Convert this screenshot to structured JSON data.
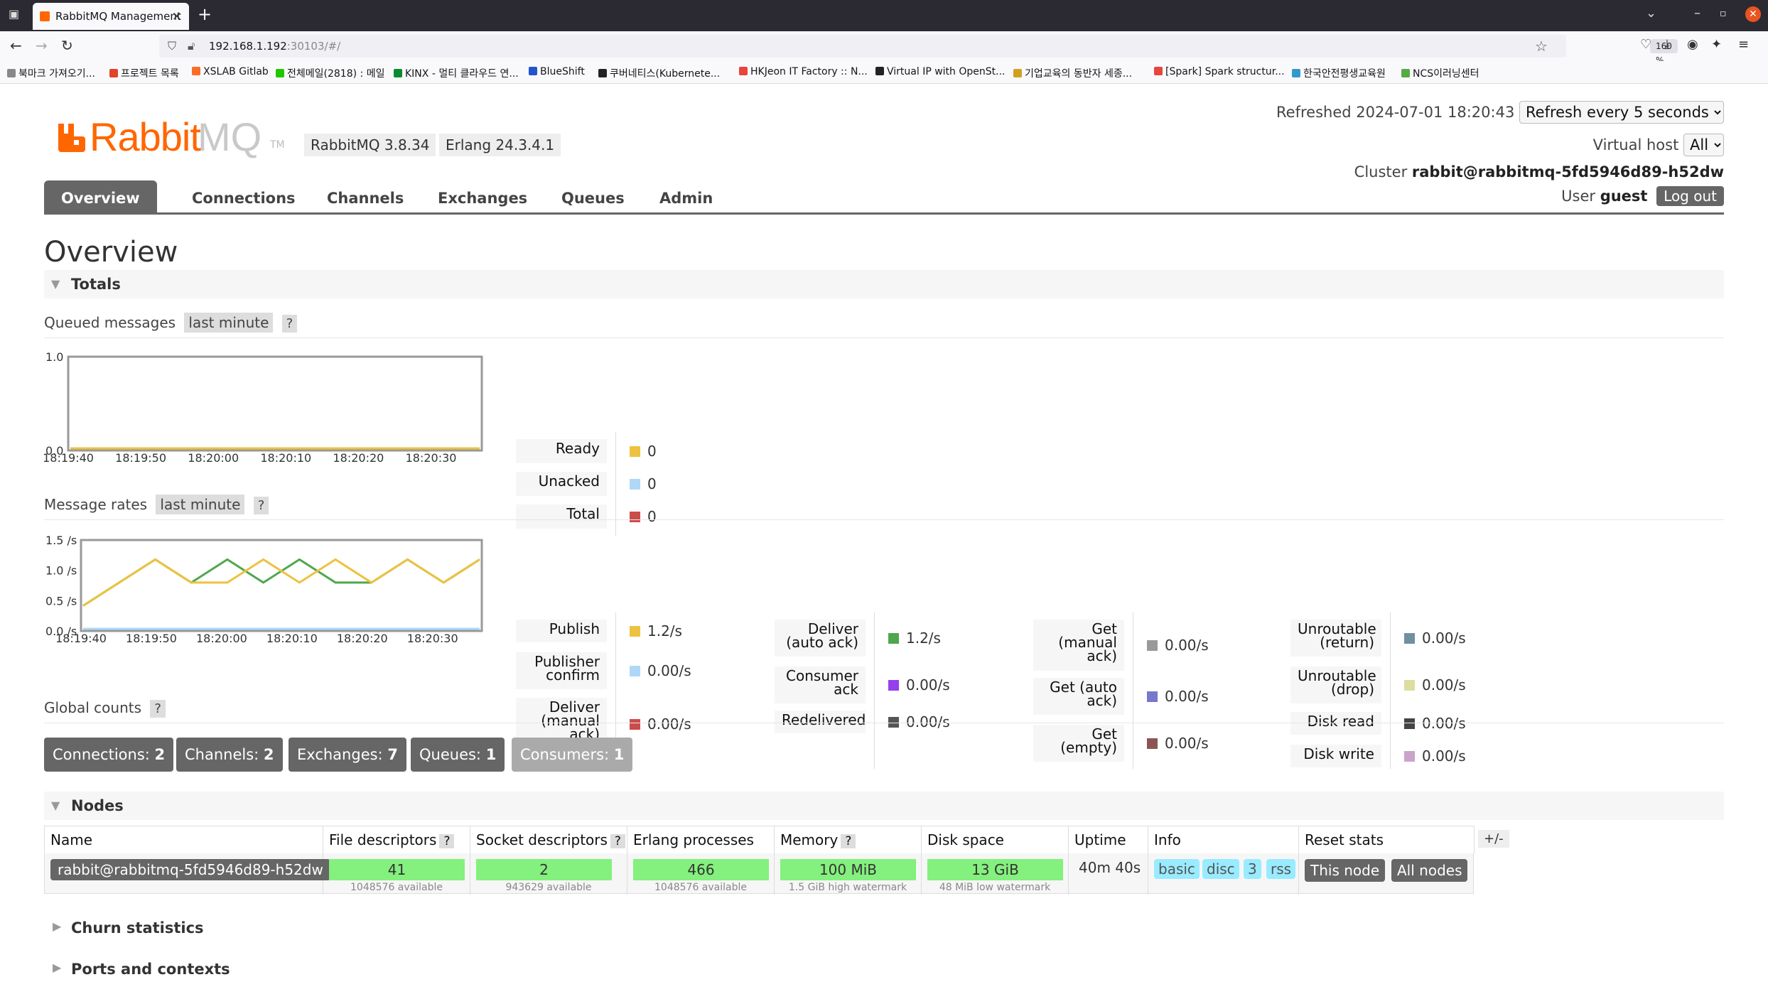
{
  "browser": {
    "tab_title": "RabbitMQ Management",
    "url_host": "192.168.1.192",
    "url_rest": ":30103/#/",
    "zoom": "160 %"
  },
  "bookmarks": [
    {
      "label": "북마크 가져오기...",
      "color": "#888888"
    },
    {
      "label": "프로젝트 목록",
      "color": "#e24329"
    },
    {
      "label": "XSLAB Gitlab",
      "color": "#fc6d26"
    },
    {
      "label": "전체메일(2818) : 메일",
      "color": "#1ec800"
    },
    {
      "label": "KINX - 멀티 클라우드 연...",
      "color": "#0a8a2e"
    },
    {
      "label": "BlueShift",
      "color": "#2255cc"
    },
    {
      "label": "쿠버네티스(Kubernete...",
      "color": "#222222"
    },
    {
      "label": "HKJeon IT Factory :: N...",
      "color": "#e8453c"
    },
    {
      "label": "Virtual IP with OpenSt...",
      "color": "#222222"
    },
    {
      "label": "기업교육의 동반자 세종...",
      "color": "#d0a020"
    },
    {
      "label": "[Spark] Spark structur...",
      "color": "#e8453c"
    },
    {
      "label": "한국안전평생교육원",
      "color": "#3399cc"
    },
    {
      "label": "NCS이러닝센터",
      "color": "#55aa44"
    }
  ],
  "header": {
    "logo_text_1": "Rabbit",
    "logo_text_2": "MQ",
    "logo_tm": "TM",
    "version": "RabbitMQ 3.8.34",
    "erlang": "Erlang 24.3.4.1",
    "refreshed_label": "Refreshed",
    "refreshed_time": "2024-07-01 18:20:43",
    "refresh_option": "Refresh every 5 seconds",
    "vhost_label": "Virtual host",
    "vhost_value": "All",
    "cluster_label": "Cluster",
    "cluster_name": "rabbit@rabbitmq-5fd5946d89-h52dw",
    "user_label": "User",
    "user_name": "guest",
    "logout": "Log out"
  },
  "menu": [
    "Overview",
    "Connections",
    "Channels",
    "Exchanges",
    "Queues",
    "Admin"
  ],
  "page_title": "Overview",
  "totals": {
    "title": "Totals",
    "queued_label": "Queued messages",
    "queued_range": "last minute",
    "rates_label": "Message rates",
    "rates_range": "last minute",
    "help": "?"
  },
  "queued_legend": [
    {
      "label": "Ready",
      "value": "0",
      "color": "#edc240"
    },
    {
      "label": "Unacked",
      "value": "0",
      "color": "#afd8f8"
    },
    {
      "label": "Total",
      "value": "0",
      "color": "#cb4b4b"
    }
  ],
  "rates_legend": [
    [
      {
        "label": "Publish",
        "value": "1.2/s",
        "color": "#edc240"
      },
      {
        "label": "Publisher confirm",
        "value": "0.00/s",
        "color": "#afd8f8"
      },
      {
        "label": "Deliver (manual ack)",
        "value": "0.00/s",
        "color": "#cb4b4b"
      }
    ],
    [
      {
        "label": "Deliver (auto ack)",
        "value": "1.2/s",
        "color": "#4da74d"
      },
      {
        "label": "Consumer ack",
        "value": "0.00/s",
        "color": "#9440ed"
      },
      {
        "label": "Redelivered",
        "value": "0.00/s",
        "color": "#555555"
      }
    ],
    [
      {
        "label": "Get (manual ack)",
        "value": "0.00/s",
        "color": "#999999"
      },
      {
        "label": "Get (auto ack)",
        "value": "0.00/s",
        "color": "#7777cc"
      },
      {
        "label": "Get (empty)",
        "value": "0.00/s",
        "color": "#8c5555"
      }
    ],
    [
      {
        "label": "Unroutable (return)",
        "value": "0.00/s",
        "color": "#7090a0"
      },
      {
        "label": "Unroutable (drop)",
        "value": "0.00/s",
        "color": "#dddda0"
      },
      {
        "label": "Disk read",
        "value": "0.00/s",
        "color": "#444444"
      },
      {
        "label": "Disk write",
        "value": "0.00/s",
        "color": "#c9a5c9"
      }
    ]
  ],
  "chart_data": [
    {
      "type": "line",
      "x": [
        "18:19:40",
        "18:19:50",
        "18:20:00",
        "18:20:10",
        "18:20:20",
        "18:20:30"
      ],
      "ylim": [
        0,
        1
      ],
      "y_ticks": [
        "0.0",
        "1.0"
      ],
      "series": [
        {
          "name": "Ready",
          "values": [
            0,
            0,
            0,
            0,
            0,
            0,
            0,
            0,
            0,
            0,
            0,
            0
          ],
          "color": "#edc240"
        },
        {
          "name": "Unacked",
          "values": [
            0,
            0,
            0,
            0,
            0,
            0,
            0,
            0,
            0,
            0,
            0,
            0
          ],
          "color": "#afd8f8"
        },
        {
          "name": "Total",
          "values": [
            0,
            0,
            0,
            0,
            0,
            0,
            0,
            0,
            0,
            0,
            0,
            0
          ],
          "color": "#cb4b4b"
        }
      ]
    },
    {
      "type": "line",
      "x": [
        "18:19:40",
        "18:19:50",
        "18:20:00",
        "18:20:10",
        "18:20:20",
        "18:20:30"
      ],
      "ylim": [
        0,
        1.5
      ],
      "y_ticks": [
        "0.0 /s",
        "0.5 /s",
        "1.0 /s",
        "1.5 /s"
      ],
      "series": [
        {
          "name": "Publish",
          "values": [
            0.4,
            0.8,
            1.2,
            0.8,
            0.8,
            1.2,
            0.8,
            1.2,
            0.8,
            1.2,
            0.8,
            1.2
          ],
          "color": "#edc240"
        },
        {
          "name": "Deliver (auto ack)",
          "values": [
            0.4,
            0.8,
            1.2,
            0.8,
            1.2,
            0.8,
            1.2,
            0.8,
            0.8,
            1.2,
            0.8,
            1.2
          ],
          "color": "#4da74d"
        },
        {
          "name": "Publisher confirm",
          "values": [
            0,
            0,
            0,
            0,
            0,
            0,
            0,
            0,
            0,
            0,
            0,
            0
          ],
          "color": "#afd8f8"
        }
      ]
    }
  ],
  "global_counts": {
    "label": "Global counts",
    "items": [
      {
        "label": "Connections:",
        "value": "2"
      },
      {
        "label": "Channels:",
        "value": "2"
      },
      {
        "label": "Exchanges:",
        "value": "7"
      },
      {
        "label": "Queues:",
        "value": "1"
      },
      {
        "label": "Consumers:",
        "value": "1"
      }
    ]
  },
  "nodes": {
    "title": "Nodes",
    "columns": [
      "Name",
      "File descriptors",
      "Socket descriptors",
      "Erlang processes",
      "Memory",
      "Disk space",
      "Uptime",
      "Info",
      "Reset stats"
    ],
    "plusminus": "+/-",
    "row": {
      "name": "rabbit@rabbitmq-5fd5946d89-h52dw",
      "file_descriptors": "41",
      "file_descriptors_sub": "1048576 available",
      "file_descriptors_fraction": 4e-05,
      "socket_descriptors": "2",
      "socket_descriptors_sub": "943629 available",
      "erlang_processes": "466",
      "erlang_processes_sub": "1048576 available",
      "memory": "100 MiB",
      "memory_sub": "1.5 GiB high watermark",
      "disk": "13 GiB",
      "disk_sub": "48 MiB low watermark",
      "uptime": "40m 40s",
      "info_tags": [
        "basic",
        "disc",
        "3",
        "rss"
      ],
      "reset_this": "This node",
      "reset_all": "All nodes"
    }
  },
  "collapsed_sections": [
    "Churn statistics",
    "Ports and contexts"
  ]
}
